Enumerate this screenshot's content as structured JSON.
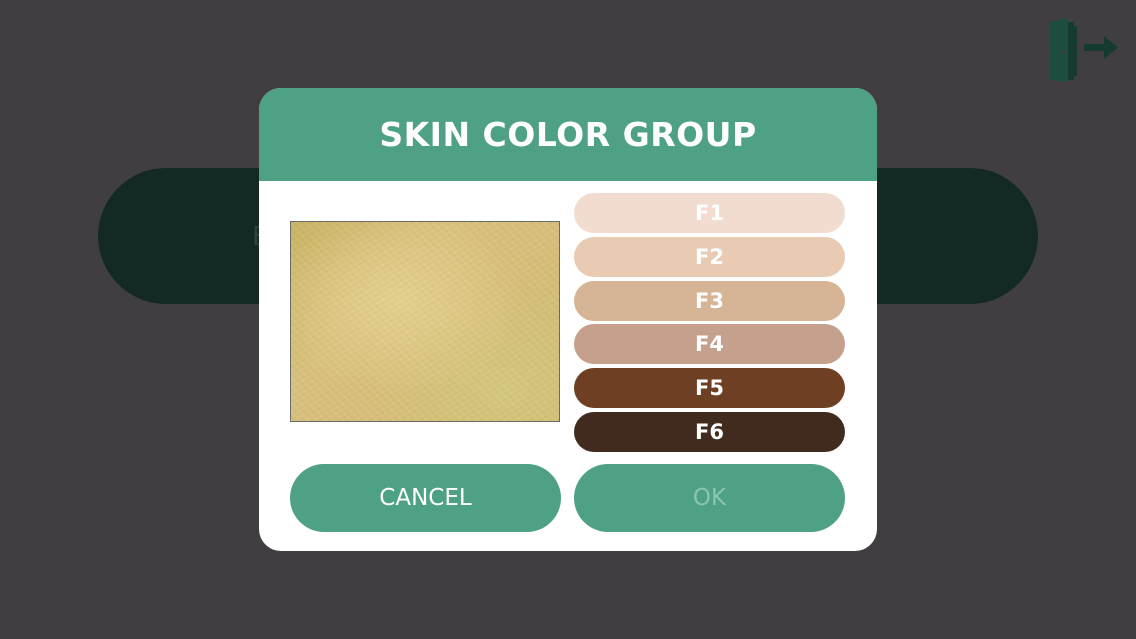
{
  "background": {
    "color": "#403e41",
    "pill_color": "#132a24",
    "hidden_letter": "E"
  },
  "exit_button": {
    "icon": "exit-door-icon",
    "color": "#153a31"
  },
  "dialog": {
    "title": "SKIN COLOR GROUP",
    "header_color": "#4ea185",
    "preview_image": "skin-sample-photo",
    "tones": [
      {
        "label": "F1",
        "color": "#f1dccf"
      },
      {
        "label": "F2",
        "color": "#e9cbb4"
      },
      {
        "label": "F3",
        "color": "#d6b596"
      },
      {
        "label": "F4",
        "color": "#c4a08d"
      },
      {
        "label": "F5",
        "color": "#6e3f22"
      },
      {
        "label": "F6",
        "color": "#412a1e"
      }
    ],
    "cancel_label": "CANCEL",
    "ok_label": "OK",
    "ok_enabled": false
  }
}
